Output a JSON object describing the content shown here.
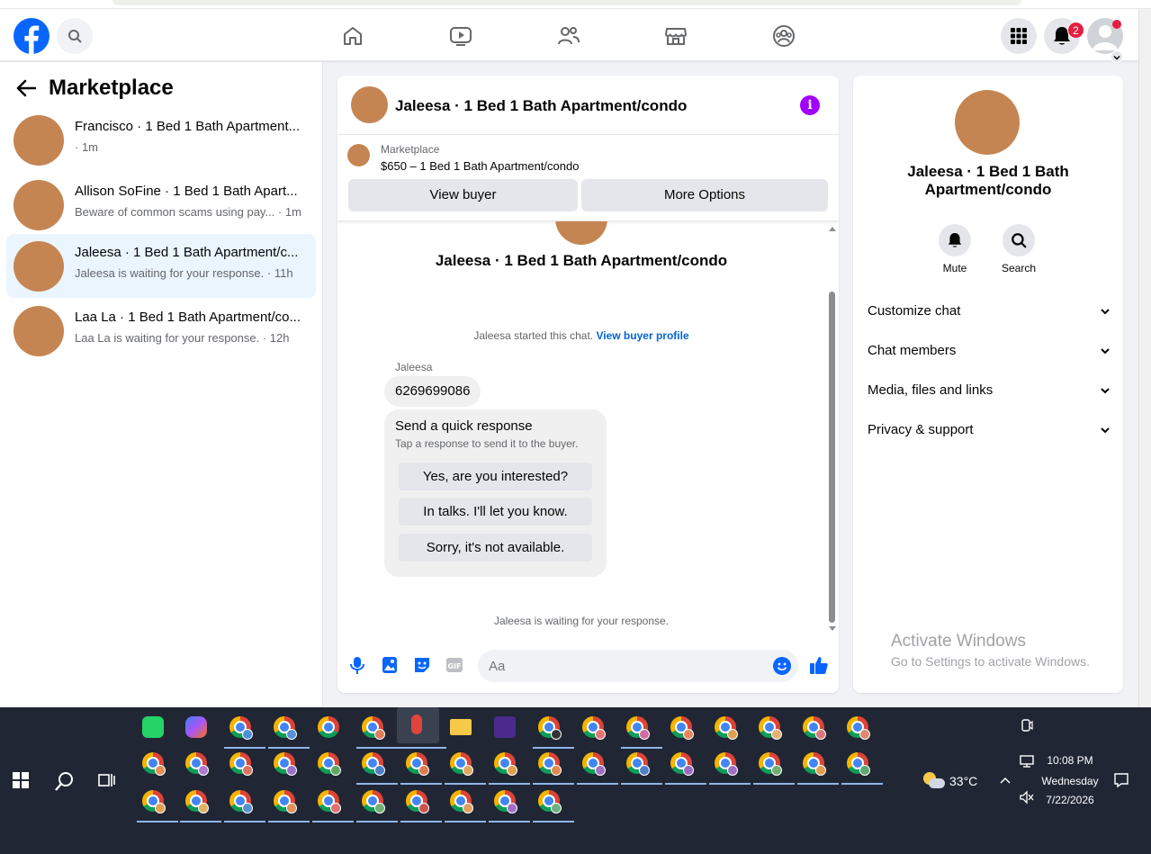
{
  "sidebar": {
    "title": "Marketplace",
    "conversations": [
      {
        "name": "Francisco · 1 Bed 1 Bath Apartment...",
        "preview": "",
        "time": "· 1m"
      },
      {
        "name": "Allison SoFine · 1 Bed 1 Bath Apart...",
        "preview": "Beware of common scams using pay...",
        "time": " · 1m"
      },
      {
        "name": "Jaleesa · 1 Bed 1 Bath Apartment/c...",
        "preview": "Jaleesa is waiting for your response.",
        "time": " · 11h"
      },
      {
        "name": "Laa La · 1 Bed 1 Bath Apartment/co...",
        "preview": "Laa La is waiting for your response.",
        "time": " · 12h"
      }
    ]
  },
  "nav": {
    "notification_count": "2"
  },
  "chat": {
    "title": "Jaleesa · 1 Bed 1 Bath Apartment/condo",
    "listing_label": "Marketplace",
    "listing_price": "$650 – 1 Bed 1 Bath Apartment/condo",
    "view_buyer": "View buyer",
    "more_options": "More Options",
    "thread_title": "Jaleesa · 1 Bed 1 Bath Apartment/condo",
    "started_text": "Jaleesa started this chat.",
    "view_profile": "View buyer profile",
    "sender": "Jaleesa",
    "message": "6269699086",
    "quick_title": "Send a quick response",
    "quick_sub": "Tap a response to send it to the buyer.",
    "quick_replies": [
      "Yes, are you interested?",
      "In talks. I'll let you know.",
      "Sorry, it's not available."
    ],
    "waiting": "Jaleesa is waiting for your response.",
    "composer_placeholder": "Aa"
  },
  "info": {
    "title": "Jaleesa · 1 Bed 1 Bath Apartment/condo",
    "mute": "Mute",
    "search": "Search",
    "sections": [
      "Customize chat",
      "Chat members",
      "Media, files and links",
      "Privacy & support"
    ],
    "activate_title": "Activate Windows",
    "activate_sub": "Go to Settings to activate Windows."
  },
  "taskbar": {
    "temperature": "33°C",
    "time": "10:08 PM",
    "day": "Wednesday",
    "date": "7/22/2026"
  },
  "colors": {
    "brand": "#0866ff",
    "accent_purple": "#a100ff",
    "badge": "#e41e3f",
    "active_row": "#ebf5ff"
  }
}
